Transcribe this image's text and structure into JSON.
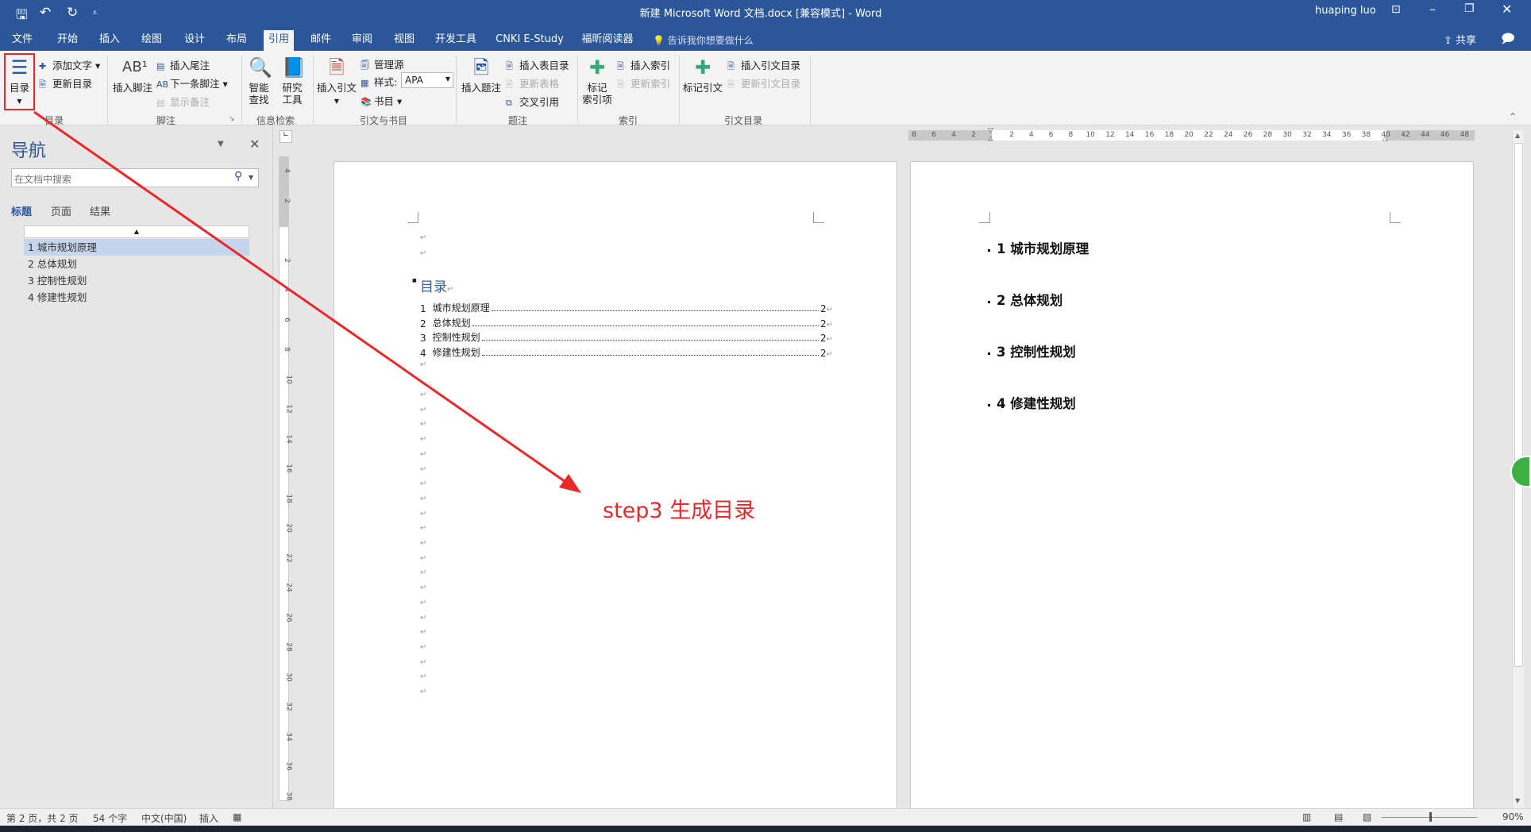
{
  "window": {
    "title": "新建 Microsoft Word 文档.docx [兼容模式] - Word",
    "user": "huaping luo",
    "share": "共享"
  },
  "quick_access": {
    "save": "🖫",
    "undo": "↶",
    "redo": "↻",
    "customize": "⩡"
  },
  "tabs": [
    {
      "label": "文件"
    },
    {
      "label": "开始"
    },
    {
      "label": "插入"
    },
    {
      "label": "绘图"
    },
    {
      "label": "设计"
    },
    {
      "label": "布局"
    },
    {
      "label": "引用",
      "selected": true
    },
    {
      "label": "邮件"
    },
    {
      "label": "审阅"
    },
    {
      "label": "视图"
    },
    {
      "label": "开发工具"
    },
    {
      "label": "CNKI E-Study"
    },
    {
      "label": "福昕阅读器"
    }
  ],
  "tell_me": "告诉我你想要做什么",
  "ribbon": {
    "toc": {
      "big": "目录",
      "add_text": "添加文字",
      "update": "更新目录",
      "group": "目录"
    },
    "footnote": {
      "big": "插入脚注",
      "endnote": "插入尾注",
      "next": "下一条脚注",
      "show": "显示备注",
      "group": "脚注"
    },
    "research": {
      "smart": "智能\n查找",
      "research": "研究\n工具",
      "group": "信息检索"
    },
    "citation": {
      "big": "插入引文",
      "manage": "管理源",
      "style_label": "样式:",
      "style_value": "APA",
      "bib": "书目",
      "group": "引文与书目"
    },
    "caption": {
      "big": "插入题注",
      "table": "插入表目录",
      "update": "更新表格",
      "cross": "交叉引用",
      "group": "题注"
    },
    "index": {
      "big": "标记\n索引项",
      "insert": "插入索引",
      "update": "更新索引",
      "group": "索引"
    },
    "authorities": {
      "big": "标记引文",
      "insert": "插入引文目录",
      "update": "更新引文目录",
      "group": "引文目录"
    }
  },
  "nav": {
    "title": "导航",
    "search_placeholder": "在文档中搜索",
    "tabs": [
      "标题",
      "页面",
      "结果"
    ],
    "headings": [
      "1 城市规划原理",
      "2 总体规划",
      "3 控制性规划",
      "4 修建性规划"
    ],
    "selected_index": 0
  },
  "ruler": {
    "h_left": [
      "8",
      "6",
      "4",
      "2"
    ],
    "h_right": [
      "2",
      "4",
      "6",
      "8",
      "10",
      "12",
      "14",
      "16",
      "18",
      "20",
      "22",
      "24",
      "26",
      "28",
      "30",
      "32",
      "34",
      "36",
      "38",
      "40",
      "42",
      "44",
      "46",
      "48"
    ],
    "v": [
      "4",
      "2",
      "",
      "2",
      "4",
      "6",
      "8",
      "10",
      "12",
      "14",
      "16",
      "18",
      "20",
      "22",
      "24",
      "26",
      "28",
      "30",
      "32",
      "34",
      "36",
      "38"
    ]
  },
  "page1": {
    "toc_title": "目录",
    "entries": [
      {
        "num": "1",
        "text": "城市规划原理",
        "page": "2"
      },
      {
        "num": "2",
        "text": "总体规划",
        "page": "2"
      },
      {
        "num": "3",
        "text": "控制性规划",
        "page": "2"
      },
      {
        "num": "4",
        "text": "修建性规划",
        "page": "2"
      }
    ],
    "paragraph_mark": "↵"
  },
  "page2": {
    "headings": [
      "1  城市规划原理",
      "2  总体规划",
      "3  控制性规划",
      "4  修建性规划"
    ]
  },
  "annotation": {
    "text_en": "step3",
    "text_cn": "生成目录",
    "color": "#e8282b"
  },
  "status": {
    "page": "第 2 页，共 2 页",
    "words": "54 个字",
    "lang": "中文(中国)",
    "mode": "插入",
    "zoom": "90%"
  },
  "colors": {
    "brand": "#2b579a",
    "highlight": "#c5d5ee"
  }
}
